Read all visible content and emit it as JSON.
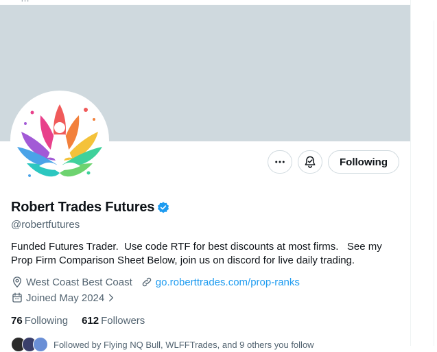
{
  "profile": {
    "display_name": "Robert Trades Futures",
    "handle": "@robertfutures",
    "bio": "Funded Futures Trader.  Use code RTF for best discounts at most firms.   See my Prop Firm Comparison Sheet Below, join us on discord for live daily trading.",
    "location": "West Coast Best Coast",
    "website": "go.roberttrades.com/prop-ranks",
    "joined": "Joined May 2024"
  },
  "actions": {
    "following_label": "Following"
  },
  "stats": {
    "following_count": "76",
    "following_label": "Following",
    "followers_count": "612",
    "followers_label": "Followers"
  },
  "followed_by": "Followed by Flying NQ Bull, WLFFTrades, and 9 others you follow",
  "top_text": "…",
  "colors": {
    "banner": "#cfd9de",
    "accent": "#1d9bf0",
    "muted": "#536471",
    "text": "#0f1419"
  },
  "icons": {
    "more": "more-horizontal-icon",
    "bell": "notification-bell-icon",
    "verified": "verified-badge-icon",
    "location": "location-pin-icon",
    "link": "link-icon",
    "calendar": "calendar-icon",
    "chevron": "chevron-right-icon"
  }
}
